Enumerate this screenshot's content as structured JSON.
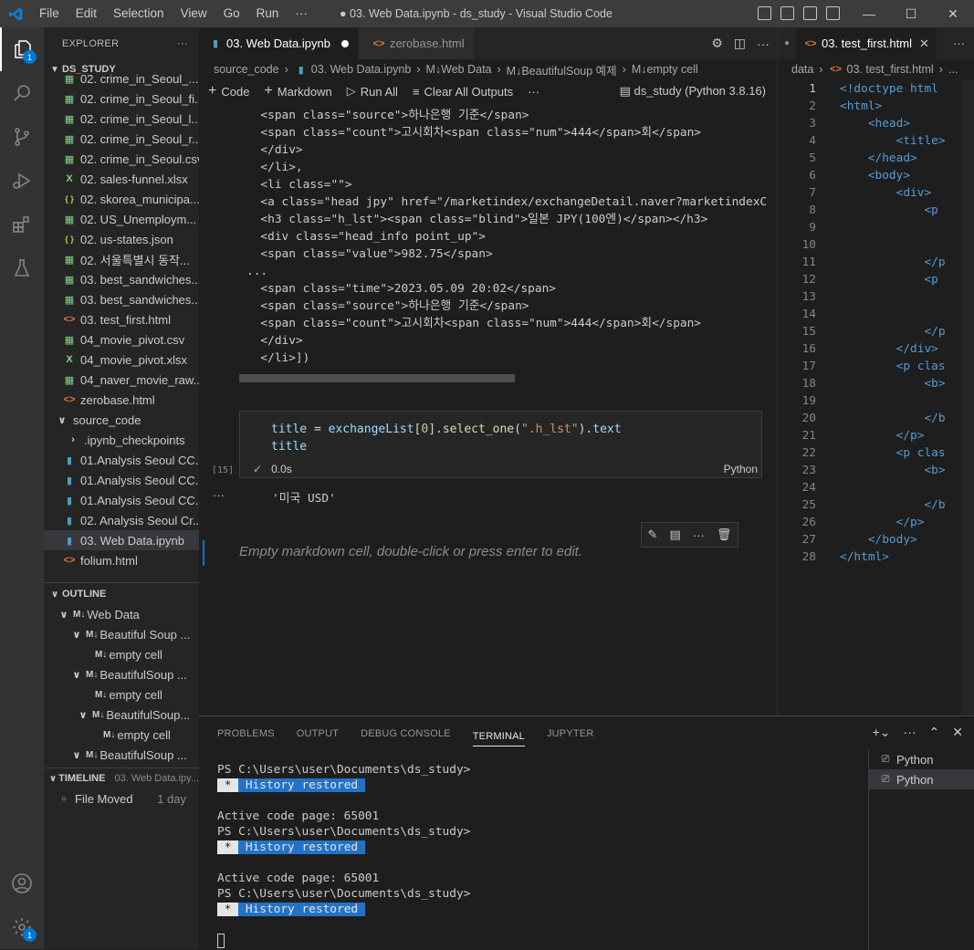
{
  "titlebar": {
    "menu": [
      "File",
      "Edit",
      "Selection",
      "View",
      "Go",
      "Run",
      "···"
    ],
    "title": "● 03. Web Data.ipynb - ds_study - Visual Studio Code",
    "minimize": "—",
    "maximize": "☐",
    "close": "✕"
  },
  "activity": {
    "badge_explorer": "1",
    "badge_settings": "1"
  },
  "sidebar": {
    "header": "EXPLORER",
    "more": "···",
    "root": "DS_STUDY",
    "files": [
      {
        "name": "02. crime_in_Seoul_...",
        "type": "csv"
      },
      {
        "name": "02. crime_in_Seoul_fi...",
        "type": "csv"
      },
      {
        "name": "02. crime_in_Seoul_l...",
        "type": "csv"
      },
      {
        "name": "02. crime_in_Seoul_r...",
        "type": "csv"
      },
      {
        "name": "02. crime_in_Seoul.csv",
        "type": "csv"
      },
      {
        "name": "02. sales-funnel.xlsx",
        "type": "xlsx"
      },
      {
        "name": "02. skorea_municipa...",
        "type": "json"
      },
      {
        "name": "02. US_Unemploym...",
        "type": "csv"
      },
      {
        "name": "02. us-states.json",
        "type": "json"
      },
      {
        "name": "02. 서울특별시 동작...",
        "type": "csv"
      },
      {
        "name": "03. best_sandwiches...",
        "type": "csv"
      },
      {
        "name": "03. best_sandwiches...",
        "type": "csv"
      },
      {
        "name": "03. test_first.html",
        "type": "html"
      },
      {
        "name": "04_movie_pivot.csv",
        "type": "csv"
      },
      {
        "name": "04_movie_pivot.xlsx",
        "type": "xlsx"
      },
      {
        "name": "04_naver_movie_raw...",
        "type": "csv"
      },
      {
        "name": "zerobase.html",
        "type": "html"
      }
    ],
    "folder": "source_code",
    "subfiles": [
      {
        "name": ".ipynb_checkpoints",
        "type": "folder"
      },
      {
        "name": "01.Analysis Seoul CC...",
        "type": "nb"
      },
      {
        "name": "01.Analysis Seoul CC...",
        "type": "nb"
      },
      {
        "name": "01.Analysis Seoul CC...",
        "type": "nb"
      },
      {
        "name": "02. Analysis Seoul Cr...",
        "type": "nb"
      },
      {
        "name": "03. Web Data.ipynb",
        "type": "nb",
        "selected": true
      },
      {
        "name": "folium.html",
        "type": "html"
      }
    ],
    "outline_header": "OUTLINE",
    "outline": [
      {
        "label": "Web Data",
        "indent": 0
      },
      {
        "label": "Beautiful Soup ...",
        "indent": 1
      },
      {
        "label": "empty cell",
        "indent": 2
      },
      {
        "label": "BeautifulSoup ...",
        "indent": 1
      },
      {
        "label": "empty cell",
        "indent": 2
      },
      {
        "label": "BeautifulSoup...",
        "indent": 1.5
      },
      {
        "label": "empty cell",
        "indent": 2.5
      },
      {
        "label": "BeautifulSoup ...",
        "indent": 1
      }
    ],
    "timeline_header": "TIMELINE",
    "timeline_file": "03. Web Data.ipy...",
    "timeline_item": "File Moved",
    "timeline_time": "1 day"
  },
  "editor": {
    "tab1": "03. Web Data.ipynb",
    "tab2": "zerobase.html",
    "crumbs": [
      "source_code",
      "03. Web Data.ipynb",
      "M↓Web Data",
      "M↓BeautifulSoup 예제",
      "M↓empty cell"
    ],
    "toolbar": {
      "code": "Code",
      "markdown": "Markdown",
      "run_all": "Run All",
      "clear": "Clear All Outputs",
      "more": "···",
      "kernel": "ds_study (Python 3.8.16)"
    },
    "output_lines": [
      "  <span class=\"source\">하나은행 기준</span>",
      "  <span class=\"count\">고시회차<span class=\"num\">444</span>회</span>",
      "  </div>",
      "  </li>,",
      "  <li class=\"\">",
      "  <a class=\"head jpy\" href=\"/marketindex/exchangeDetail.naver?marketindexC",
      "  <h3 class=\"h_lst\"><span class=\"blind\">일본 JPY(100엔)</span></h3>",
      "  <div class=\"head_info point_up\">",
      "  <span class=\"value\">982.75</span>",
      "...",
      "  <span class=\"time\">2023.05.09 20:02</span>",
      "  <span class=\"source\">하나은행 기준</span>",
      "  <span class=\"count\">고시회차<span class=\"num\">444</span>회</span>",
      "  </div>",
      "  </li>])"
    ],
    "cell": {
      "var": "title",
      "eq": " = ",
      "obj": "exchangeList",
      "idx_open": "[",
      "idx": "0",
      "idx_close": "].",
      "method": "select_one",
      "arg_open": "(",
      "arg": "\".h_lst\"",
      "arg_close": ").",
      "prop": "text",
      "line2": "title",
      "exec": "[15]",
      "time": "0.0s",
      "lang": "Python"
    },
    "result": "'미국 USD'",
    "result_dots": "···",
    "markdown_placeholder": "Empty markdown cell, double-click or press enter to edit."
  },
  "right": {
    "tab": "03. test_first.html",
    "crumbs": [
      "data",
      "03. test_first.html",
      "..."
    ],
    "lines": [
      "<!doctype html",
      "<html>",
      "    <head>",
      "        <title>",
      "    </head>",
      "    <body>",
      "        <div>",
      "            <p",
      "",
      "",
      "            </p",
      "            <p",
      "",
      "",
      "            </p",
      "        </div>",
      "        <p clas",
      "            <b>",
      "",
      "            </b",
      "        </p>",
      "        <p clas",
      "            <b>",
      "",
      "            </b",
      "        </p>",
      "    </body>",
      "</html>"
    ]
  },
  "panel": {
    "tabs": [
      "PROBLEMS",
      "OUTPUT",
      "DEBUG CONSOLE",
      "TERMINAL",
      "JUPYTER"
    ],
    "prompt": "PS C:\\Users\\user\\Documents\\ds_study>",
    "history": " History restored ",
    "star": " * ",
    "codepage": "Active code page: 65001",
    "terms": [
      "Python",
      "Python"
    ]
  }
}
